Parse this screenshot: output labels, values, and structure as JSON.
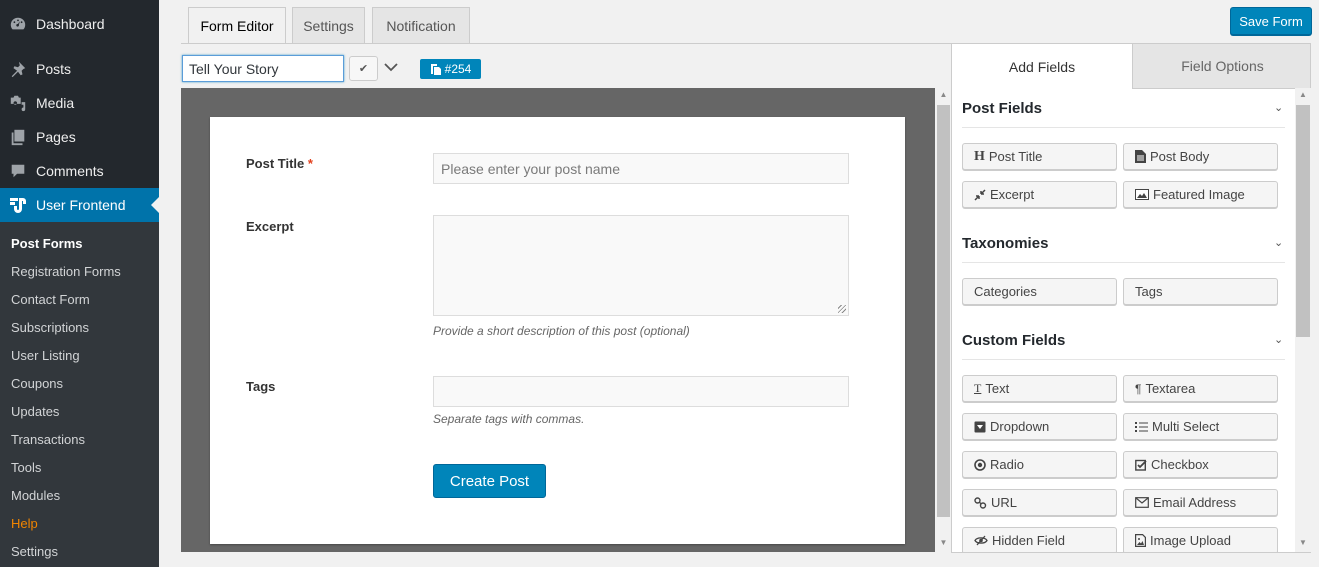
{
  "sidebar": {
    "menu": [
      {
        "label": "Dashboard",
        "icon": "dashboard-icon"
      },
      {
        "label": "Posts",
        "icon": "pin-icon"
      },
      {
        "label": "Media",
        "icon": "media-icon"
      },
      {
        "label": "Pages",
        "icon": "pages-icon"
      },
      {
        "label": "Comments",
        "icon": "comment-icon"
      },
      {
        "label": "User Frontend",
        "icon": "user-frontend-logo-icon",
        "active": true
      }
    ],
    "submenu": [
      {
        "label": "Post Forms",
        "current": true
      },
      {
        "label": "Registration Forms"
      },
      {
        "label": "Contact Form"
      },
      {
        "label": "Subscriptions"
      },
      {
        "label": "User Listing"
      },
      {
        "label": "Coupons"
      },
      {
        "label": "Updates"
      },
      {
        "label": "Transactions"
      },
      {
        "label": "Tools"
      },
      {
        "label": "Modules"
      },
      {
        "label": "Help",
        "highlight_color": "#f18500"
      },
      {
        "label": "Settings"
      }
    ]
  },
  "tabs": [
    {
      "label": "Form Editor",
      "active": true
    },
    {
      "label": "Settings"
    },
    {
      "label": "Notification"
    }
  ],
  "toolbar": {
    "save_label": "Save Form",
    "form_name": "Tell Your Story",
    "shortcode": "#254"
  },
  "form_preview": {
    "fields": [
      {
        "label": "Post Title",
        "required_mark": "*",
        "placeholder": "Please enter your post name",
        "help": ""
      },
      {
        "label": "Excerpt",
        "placeholder": "",
        "help": "Provide a short description of this post (optional)"
      },
      {
        "label": "Tags",
        "placeholder": "",
        "help": "Separate tags with commas."
      }
    ],
    "submit_label": "Create Post"
  },
  "right_panel": {
    "tabs": [
      {
        "label": "Add Fields",
        "active": true
      },
      {
        "label": "Field Options"
      }
    ],
    "sections": [
      {
        "title": "Post Fields",
        "buttons": [
          {
            "label": "Post Title",
            "icon": "heading-icon"
          },
          {
            "label": "Post Body",
            "icon": "document-icon"
          },
          {
            "label": "Excerpt",
            "icon": "compress-icon"
          },
          {
            "label": "Featured Image",
            "icon": "image-icon"
          }
        ]
      },
      {
        "title": "Taxonomies",
        "buttons": [
          {
            "label": "Categories"
          },
          {
            "label": "Tags"
          }
        ]
      },
      {
        "title": "Custom Fields",
        "buttons": [
          {
            "label": "Text",
            "icon": "text-cursor-icon"
          },
          {
            "label": "Textarea",
            "icon": "paragraph-icon"
          },
          {
            "label": "Dropdown",
            "icon": "dropdown-icon"
          },
          {
            "label": "Multi Select",
            "icon": "list-icon"
          },
          {
            "label": "Radio",
            "icon": "radio-icon"
          },
          {
            "label": "Checkbox",
            "icon": "checkbox-icon"
          },
          {
            "label": "URL",
            "icon": "link-icon"
          },
          {
            "label": "Email Address",
            "icon": "envelope-icon"
          },
          {
            "label": "Hidden Field",
            "icon": "eye-slash-icon"
          },
          {
            "label": "Image Upload",
            "icon": "image-file-icon"
          }
        ]
      }
    ]
  },
  "colors": {
    "accent": "#0085ba",
    "sidebar_bg": "#23282d",
    "submenu_bg": "#32373c",
    "active_menu": "#0073aa",
    "required": "#e2401c",
    "help_link": "#f18500"
  }
}
